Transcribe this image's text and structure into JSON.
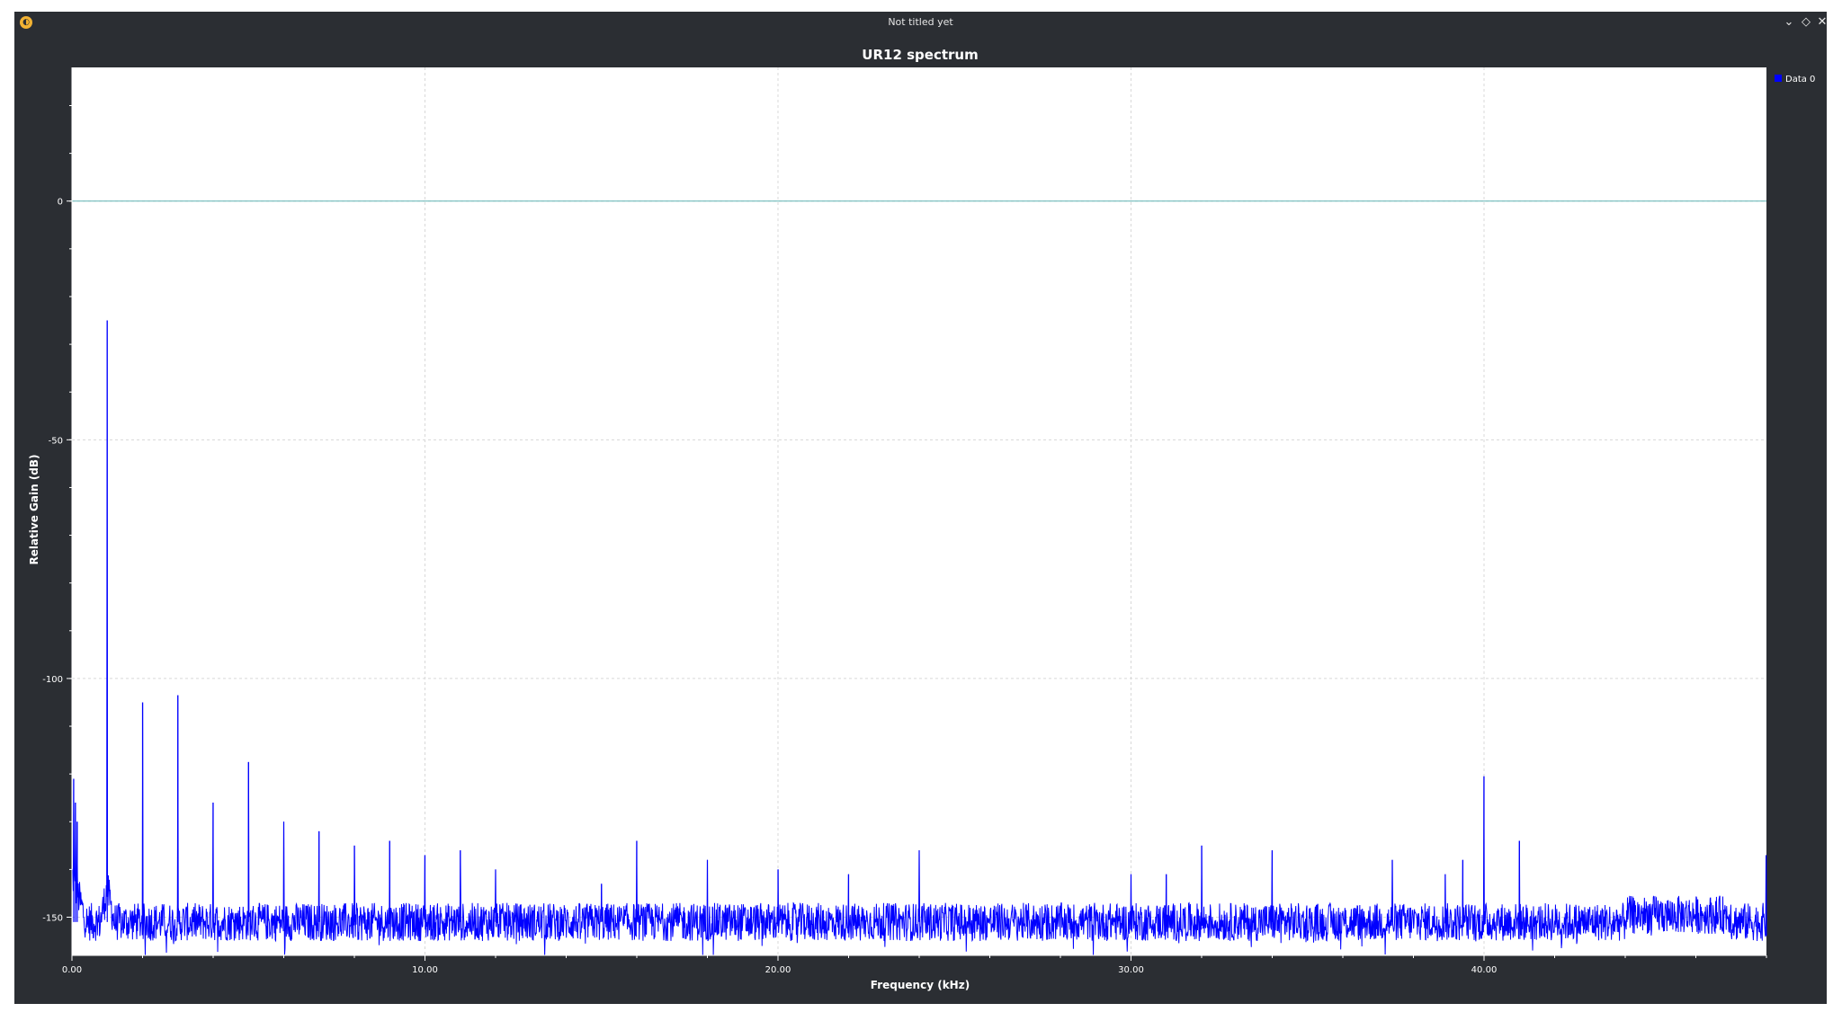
{
  "window": {
    "title": "Not titled yet",
    "app_icon_glyph": "◐",
    "buttons": {
      "minimize_icon": "chevron-down-icon",
      "maximize_icon": "diamond-icon",
      "close_icon": "close-icon"
    }
  },
  "colors": {
    "window_bg": "#2b2e33",
    "plot_bg": "#ffffff",
    "series": "#0000ff",
    "zero_line": "#5fb3b3",
    "grid": "#d8d8d8"
  },
  "chart_data": {
    "type": "line",
    "title": "UR12 spectrum",
    "xlabel": "Frequency (kHz)",
    "ylabel": "Relative Gain (dB)",
    "xlim": [
      0,
      48
    ],
    "ylim": [
      -158,
      28
    ],
    "x_ticks": [
      0,
      10,
      20,
      30,
      40
    ],
    "x_tick_labels": [
      "0.00",
      "10.00",
      "20.00",
      "30.00",
      "40.00"
    ],
    "y_ticks": [
      0,
      -50,
      -100,
      -150
    ],
    "y_tick_labels": [
      "0",
      "-50",
      "-100",
      "-150"
    ],
    "grid": true,
    "legend_position": "top-right",
    "reference_line": 0,
    "series": [
      {
        "name": "Data 0",
        "noise_floor": -151,
        "noise_amplitude": 4,
        "peaks": [
          {
            "x": 0.05,
            "y": -121
          },
          {
            "x": 0.1,
            "y": -126
          },
          {
            "x": 0.15,
            "y": -130
          },
          {
            "x": 1.0,
            "y": -25
          },
          {
            "x": 2.0,
            "y": -105
          },
          {
            "x": 3.0,
            "y": -103.5
          },
          {
            "x": 4.0,
            "y": -126
          },
          {
            "x": 5.0,
            "y": -117.5
          },
          {
            "x": 6.0,
            "y": -130
          },
          {
            "x": 7.0,
            "y": -132
          },
          {
            "x": 8.0,
            "y": -135
          },
          {
            "x": 9.0,
            "y": -134
          },
          {
            "x": 10.0,
            "y": -137
          },
          {
            "x": 11.0,
            "y": -136
          },
          {
            "x": 12.0,
            "y": -140
          },
          {
            "x": 15.0,
            "y": -143
          },
          {
            "x": 16.0,
            "y": -134
          },
          {
            "x": 18.0,
            "y": -138
          },
          {
            "x": 20.0,
            "y": -140
          },
          {
            "x": 22.0,
            "y": -141
          },
          {
            "x": 24.0,
            "y": -136
          },
          {
            "x": 30.0,
            "y": -141
          },
          {
            "x": 31.0,
            "y": -141
          },
          {
            "x": 32.0,
            "y": -135
          },
          {
            "x": 34.0,
            "y": -136
          },
          {
            "x": 37.4,
            "y": -138
          },
          {
            "x": 38.9,
            "y": -141
          },
          {
            "x": 39.4,
            "y": -138
          },
          {
            "x": 40.0,
            "y": -120.5
          },
          {
            "x": 41.0,
            "y": -134
          },
          {
            "x": 47.99,
            "y": -137
          }
        ]
      }
    ]
  }
}
